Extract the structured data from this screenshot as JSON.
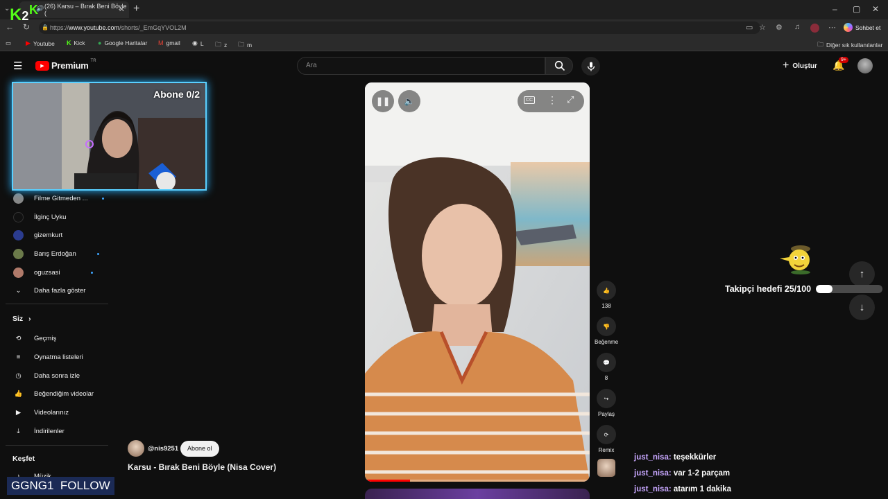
{
  "browser": {
    "tab_title": "(26) Karsu – Bırak Beni Böyle (",
    "url_prefix": "https://",
    "url_domain": "www.youtube.com",
    "url_path": "/shorts/_EmGqYVOL2M",
    "copilot_label": "Sohbet et",
    "bookmarks": [
      "Youtube",
      "Kick",
      "Google Haritalar",
      "gmail",
      "L",
      "z",
      "m"
    ],
    "other_bookmarks": "Diğer sık kullanılanlar"
  },
  "youtube": {
    "logo_text": "Premium",
    "logo_region": "TR",
    "search_placeholder": "Ara",
    "create_label": "Oluştur",
    "notif_badge": "9+",
    "subscriptions": [
      {
        "name": "Filme Gitmeden ..."
      },
      {
        "name": "İlginç Uyku"
      },
      {
        "name": "gizemkurt"
      },
      {
        "name": "Barış Erdoğan"
      },
      {
        "name": "oguzsasi"
      }
    ],
    "show_more": "Daha fazla göster",
    "you_section": "Siz",
    "you_items": [
      "Geçmiş",
      "Oynatma listeleri",
      "Daha sonra izle",
      "Beğendiğim videolar",
      "Videolarınız",
      "İndirilenler"
    ],
    "explore_section": "Keşfet",
    "explore_items": [
      "Müzik"
    ],
    "short": {
      "channel": "@nis9251",
      "subscribe_label": "Abone ol",
      "title": "Karsu - Bırak Beni Böyle (Nisa Cover)",
      "likes": "138",
      "dislike_label": "Beğenme",
      "comments": "8",
      "share_label": "Paylaş",
      "remix_label": "Remix"
    }
  },
  "overlay": {
    "sub_goal": "Abone 0/2",
    "follower_goal": "Takipçi hedefi 25/100",
    "follower_progress": 0.25,
    "bottom_banner": "GGNG1  FOLLOW",
    "chat": [
      {
        "user": "just_nisa:",
        "msg": "teşekkürler"
      },
      {
        "user": "just_nisa:",
        "msg": "var 1-2 parçam"
      },
      {
        "user": "just_nisa:",
        "msg": "atarım 1 dakika"
      }
    ]
  }
}
